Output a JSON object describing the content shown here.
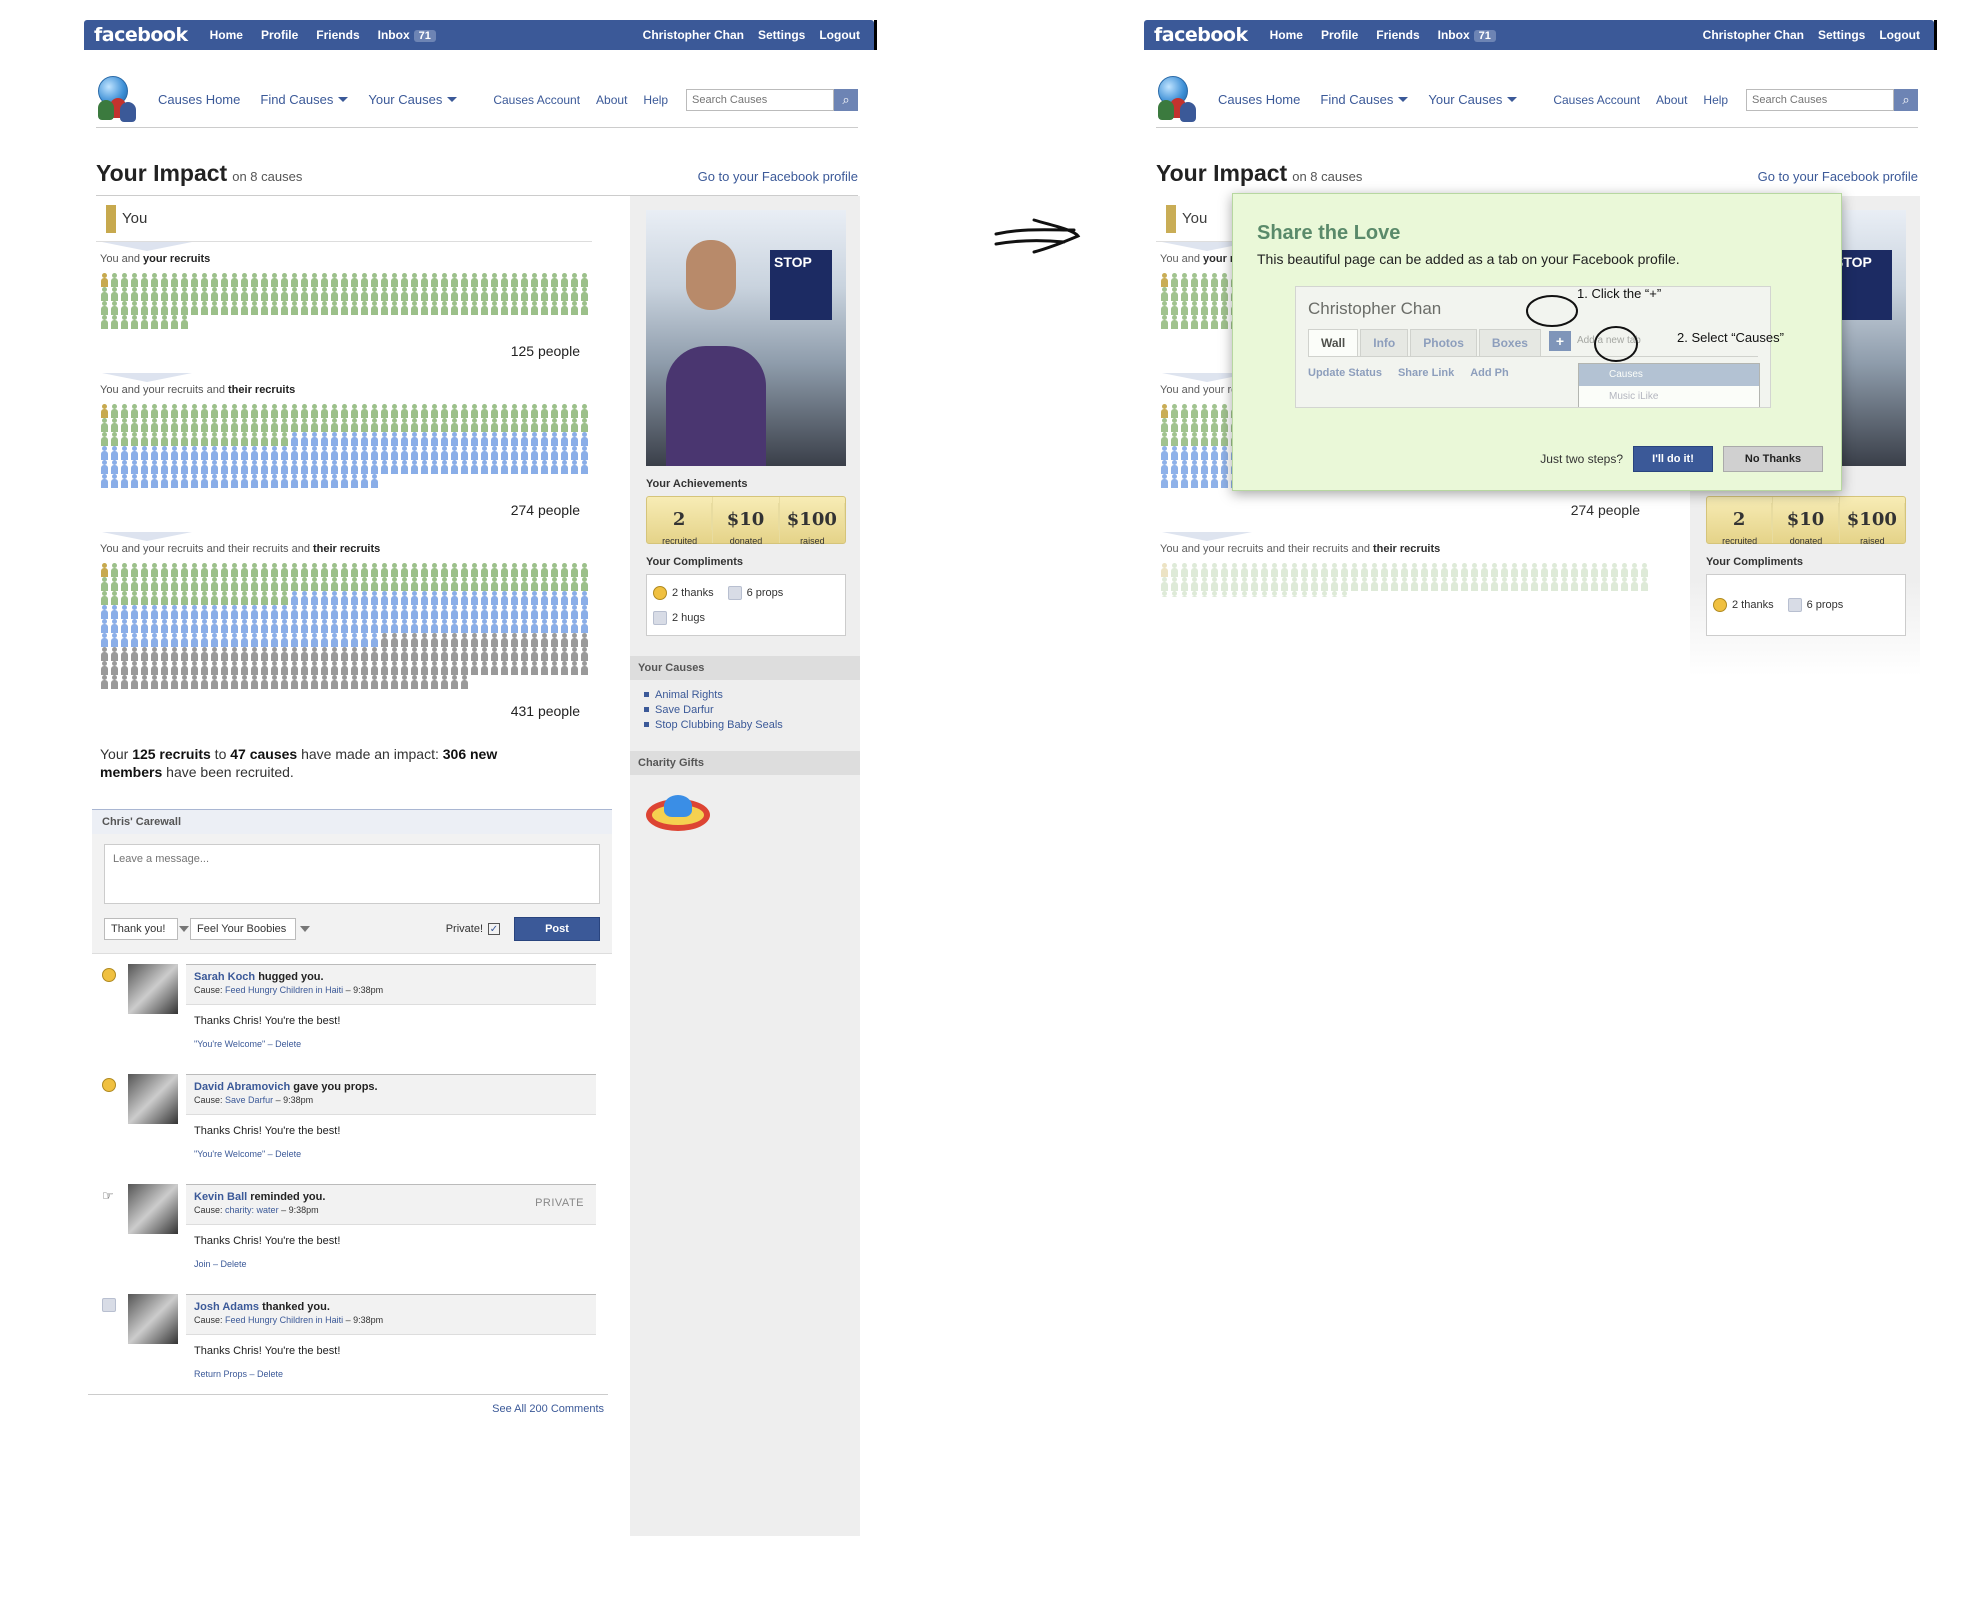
{
  "fb_bar": {
    "logo": "facebook",
    "nav": [
      "Home",
      "Profile",
      "Friends",
      "Inbox"
    ],
    "inbox_count": "71",
    "right": [
      "Christopher Chan",
      "Settings",
      "Logout"
    ]
  },
  "app_bar": {
    "items": [
      "Causes Home",
      "Find Causes",
      "Your Causes"
    ],
    "secondary": [
      "Causes Account",
      "About",
      "Help"
    ],
    "search_placeholder": "Search Causes"
  },
  "title": {
    "heading": "Your Impact",
    "sub": "on 8 causes",
    "profile_link": "Go to your Facebook profile"
  },
  "you_label": "You",
  "sections": [
    {
      "prefix": "You and ",
      "bold": "your recruits",
      "count": "125 people"
    },
    {
      "prefix": "You and your recruits and ",
      "bold": "their recruits",
      "count": "274 people"
    },
    {
      "prefix": "You and your recruits and their recruits and ",
      "bold": "their recruits",
      "count": "431 people"
    }
  ],
  "summary": {
    "p1": "Your ",
    "b1": "125 recruits",
    "p2": " to ",
    "b2": "47 causes",
    "p3": " have made an impact: ",
    "b3": "306 new members",
    "p4": " have been recruited."
  },
  "wall": {
    "title": "Chris' Carewall",
    "placeholder": "Leave a message...",
    "select1": "Thank you!",
    "select2": "Feel Your Boobies",
    "private_label": "Private!",
    "post_label": "Post",
    "see_all": "See All 200 Comments"
  },
  "comments": [
    {
      "name": "Sarah Koch",
      "action": "hugged you.",
      "cause_label": "Cause:",
      "cause": "Feed Hungry Children in Haiti",
      "time": "– 9:38pm",
      "text": "Thanks Chris! You're the best!",
      "links": "\"You're Welcome\" – Delete",
      "tag": ""
    },
    {
      "name": "David Abramovich",
      "action": "gave you props.",
      "cause_label": "Cause:",
      "cause": "Save Darfur",
      "time": "– 9:38pm",
      "text": "Thanks Chris! You're the best!",
      "links": "\"You're Welcome\" – Delete",
      "tag": ""
    },
    {
      "name": "Kevin Ball",
      "action": "reminded you.",
      "cause_label": "Cause:",
      "cause": "charity: water",
      "time": "– 9:38pm",
      "text": "Thanks Chris! You're the best!",
      "links": "Join – Delete",
      "tag": "PRIVATE"
    },
    {
      "name": "Josh Adams",
      "action": "thanked you.",
      "cause_label": "Cause:",
      "cause": "Feed Hungry Children in Haiti",
      "time": "– 9:38pm",
      "text": "Thanks Chris! You're the best!",
      "links": "Return Props – Delete",
      "tag": ""
    }
  ],
  "sidebar": {
    "achievements_title": "Your Achievements",
    "achievements": [
      {
        "value": "2",
        "label": "recruited"
      },
      {
        "value": "$10",
        "label": "donated"
      },
      {
        "value": "$100",
        "label": "raised"
      }
    ],
    "compliments_title": "Your Compliments",
    "compliments": [
      "2 thanks",
      "6 props",
      "2 hugs"
    ],
    "causes_title": "Your Causes",
    "causes": [
      "Animal Rights",
      "Save Darfur",
      "Stop Clubbing Baby Seals"
    ],
    "gifts_title": "Charity Gifts",
    "photo_sign": "STOP"
  },
  "overlay": {
    "title": "Share the Love",
    "desc": "This beautiful page can be added as a tab on your Facebook profile.",
    "profile_name": "Christopher Chan",
    "tabs": [
      "Wall",
      "Info",
      "Photos",
      "Boxes"
    ],
    "add_tab": "Add a new tab",
    "actions": [
      "Update Status",
      "Share Link",
      "Add Ph"
    ],
    "dropdown": [
      "Causes",
      "Music iLike"
    ],
    "step1": "1. Click the “+”",
    "step2": "2. Select “Causes”",
    "question": "Just two steps?",
    "do_it": "I'll do it!",
    "no_thanks": "No Thanks"
  },
  "colors": {
    "fb_blue": "#3b5998",
    "recruit_green": "#9cc08a",
    "recruit_blue": "#8aaee8",
    "recruit_grey": "#9a9a9a",
    "overlay_bg": "#eaf8d8"
  }
}
